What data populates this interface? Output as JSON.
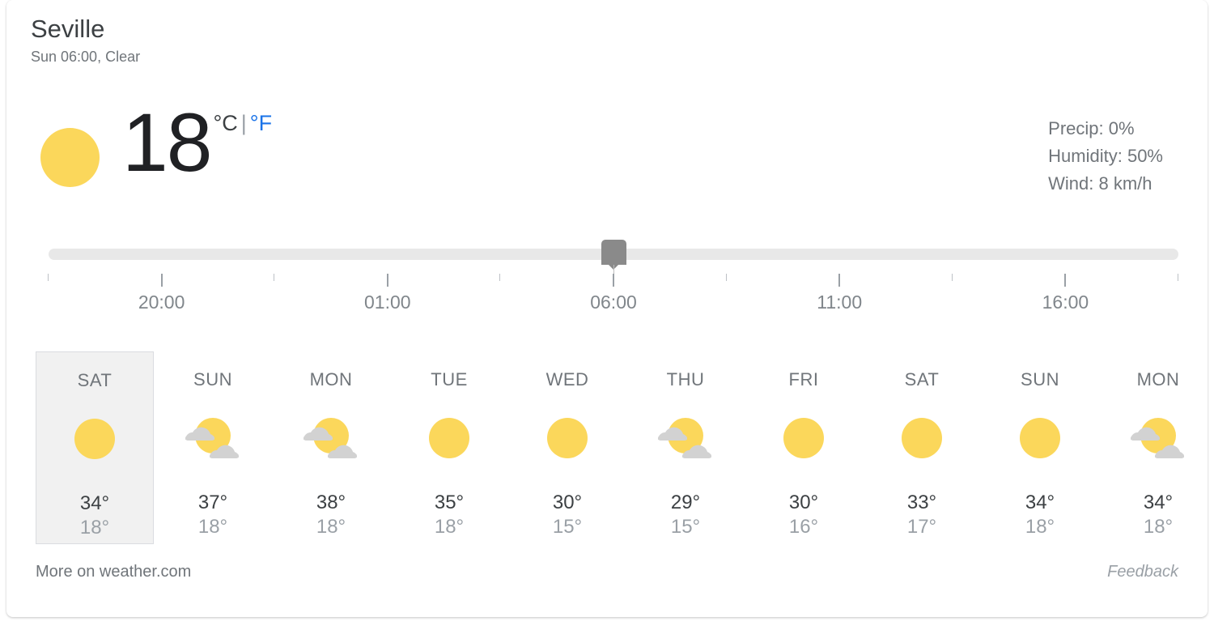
{
  "card": {
    "location": "Seville",
    "subtitle": "Sun 06:00, Clear"
  },
  "current": {
    "icon": "sun-icon",
    "temperature": "18",
    "unit_celsius": "°C",
    "unit_separator": "|",
    "unit_fahrenheit": "°F",
    "active_unit": "C",
    "precip": "Precip: 0%",
    "humidity": "Humidity: 50%",
    "wind": "Wind: 8 km/h"
  },
  "slider": {
    "value_position_pct": 50,
    "time_labels": [
      {
        "label": "20:00",
        "pos_pct": 10
      },
      {
        "label": "01:00",
        "pos_pct": 30
      },
      {
        "label": "06:00",
        "pos_pct": 50
      },
      {
        "label": "11:00",
        "pos_pct": 70
      },
      {
        "label": "16:00",
        "pos_pct": 90
      }
    ],
    "ticks": [
      {
        "pos_pct": 0,
        "type": "minor"
      },
      {
        "pos_pct": 10,
        "type": "major"
      },
      {
        "pos_pct": 20,
        "type": "minor"
      },
      {
        "pos_pct": 30,
        "type": "major"
      },
      {
        "pos_pct": 40,
        "type": "minor"
      },
      {
        "pos_pct": 50,
        "type": "major"
      },
      {
        "pos_pct": 60,
        "type": "minor"
      },
      {
        "pos_pct": 70,
        "type": "major"
      },
      {
        "pos_pct": 80,
        "type": "minor"
      },
      {
        "pos_pct": 90,
        "type": "major"
      },
      {
        "pos_pct": 100,
        "type": "minor"
      }
    ]
  },
  "forecast": {
    "days": [
      {
        "name": "SAT",
        "icon": "sun-icon",
        "high": "34°",
        "low": "18°",
        "selected": true
      },
      {
        "name": "SUN",
        "icon": "partly-cloudy-icon",
        "high": "37°",
        "low": "18°",
        "selected": false
      },
      {
        "name": "MON",
        "icon": "partly-cloudy-icon",
        "high": "38°",
        "low": "18°",
        "selected": false
      },
      {
        "name": "TUE",
        "icon": "sun-icon",
        "high": "35°",
        "low": "18°",
        "selected": false
      },
      {
        "name": "WED",
        "icon": "sun-icon",
        "high": "30°",
        "low": "15°",
        "selected": false
      },
      {
        "name": "THU",
        "icon": "partly-cloudy-icon",
        "high": "29°",
        "low": "15°",
        "selected": false
      },
      {
        "name": "FRI",
        "icon": "sun-icon",
        "high": "30°",
        "low": "16°",
        "selected": false
      },
      {
        "name": "SAT",
        "icon": "sun-icon",
        "high": "33°",
        "low": "17°",
        "selected": false
      },
      {
        "name": "SUN",
        "icon": "sun-icon",
        "high": "34°",
        "low": "18°",
        "selected": false
      },
      {
        "name": "MON",
        "icon": "partly-cloudy-icon",
        "high": "34°",
        "low": "18°",
        "selected": false
      }
    ]
  },
  "footer": {
    "more_link": "More on weather.com",
    "feedback_link": "Feedback"
  },
  "colors": {
    "sun_yellow": "#fbd75b",
    "cloud_gray": "#d2d2d2",
    "accent_blue": "#1a73e8",
    "text_primary": "#3c4043",
    "text_secondary": "#70757a",
    "track_gray": "#e8e8e8",
    "thumb_gray": "#8a8a8a"
  }
}
